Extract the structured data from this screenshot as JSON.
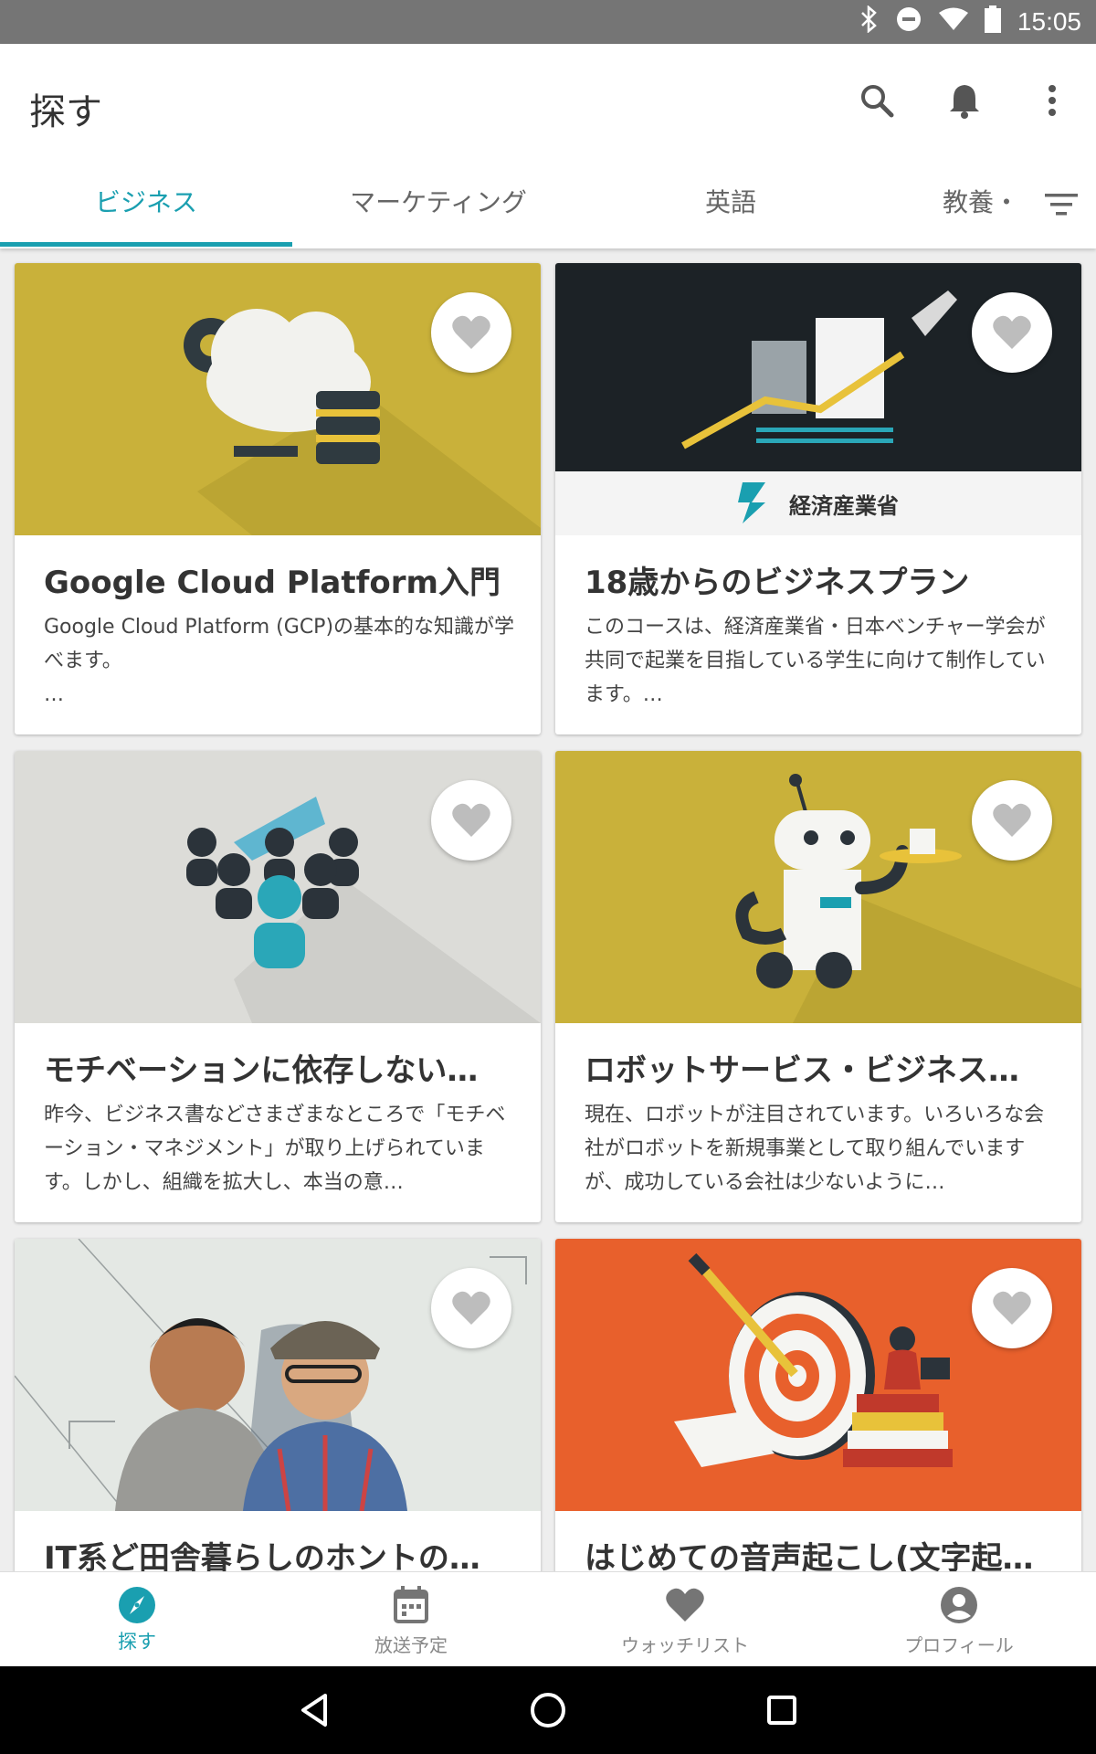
{
  "status_bar": {
    "time": "15:05",
    "icons": [
      "bluetooth-icon",
      "do-not-disturb-icon",
      "wifi-icon",
      "battery-icon"
    ]
  },
  "app_bar": {
    "title": "探す",
    "icons": [
      "search-icon",
      "bell-icon",
      "more-vert-icon"
    ]
  },
  "tabs": {
    "items": [
      {
        "label": "ビジネス",
        "active": true
      },
      {
        "label": "マーケティング",
        "active": false
      },
      {
        "label": "英語",
        "active": false
      }
    ],
    "more_label": "教養・",
    "filter_icon": "filter-icon",
    "active_color": "#1a9fb0"
  },
  "cards": [
    {
      "title": "Google Cloud Platform入門",
      "desc": "Google Cloud Platform (GCP)の基本的な知識が学べます。\n…",
      "thumb_bg": "#c9b13a",
      "thumb_theme": "cloud-database",
      "favorite_icon": "heart-icon"
    },
    {
      "title": "18歳からのビジネスプラン",
      "desc": "このコースは、経済産業省・日本ベンチャー学会が共同で起業を目指している学生に向けて制作しています。…",
      "thumb_bg": "#1c2226",
      "thumb_theme": "rocket-chart",
      "thumb_caption": "経済産業省",
      "favorite_icon": "heart-icon"
    },
    {
      "title": "モチベーションに依存しない…",
      "desc": "昨今、ビジネス書などさまざまなところで「モチベーション・マネジメント」が取り上げられています。しかし、組織を拡大し、本当の意…",
      "thumb_bg": "#dcdcd8",
      "thumb_theme": "people-group",
      "favorite_icon": "heart-icon"
    },
    {
      "title": "ロボットサービス・ビジネス…",
      "desc": "現在、ロボットが注目されています。いろいろな会社がロボットを新規事業として取り組んでいますが、成功している会社は少ないように…",
      "thumb_bg": "#c9b13a",
      "thumb_theme": "robot",
      "favorite_icon": "heart-icon"
    },
    {
      "title": "IT系ど田舎暮らしのホントの…",
      "desc": "",
      "thumb_bg": "#e4e8e4",
      "thumb_theme": "two-men-photo",
      "favorite_icon": "heart-icon"
    },
    {
      "title": "はじめての音声起こし(文字起…",
      "desc": "",
      "thumb_bg": "#e8602c",
      "thumb_theme": "target-books",
      "favorite_icon": "heart-icon"
    }
  ],
  "bottom_nav": [
    {
      "label": "探す",
      "icon": "compass-icon",
      "active": true
    },
    {
      "label": "放送予定",
      "icon": "calendar-icon",
      "active": false
    },
    {
      "label": "ウォッチリスト",
      "icon": "heart-icon",
      "active": false
    },
    {
      "label": "プロフィール",
      "icon": "account-icon",
      "active": false
    }
  ],
  "system_nav": [
    "back-icon",
    "home-icon",
    "recents-icon"
  ]
}
